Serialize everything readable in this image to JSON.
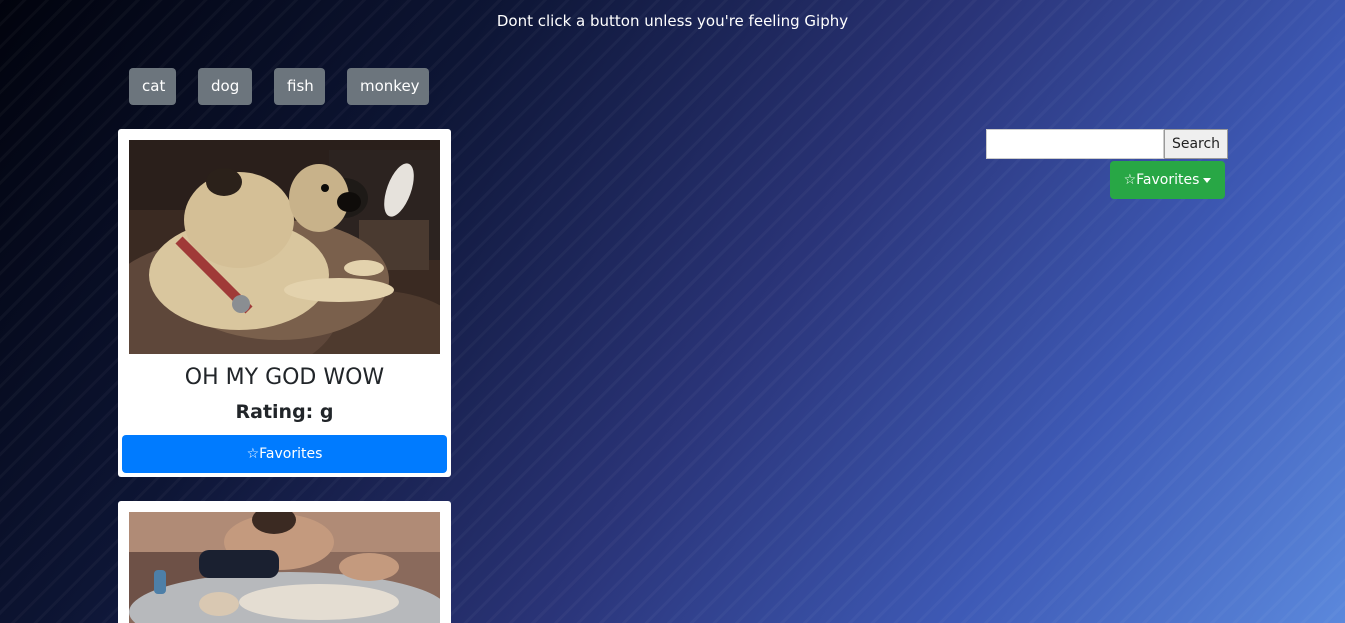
{
  "header": {
    "tagline": "Dont click a button unless you're feeling Giphy"
  },
  "topics": [
    {
      "label": "cat"
    },
    {
      "label": "dog"
    },
    {
      "label": "fish"
    },
    {
      "label": "monkey"
    }
  ],
  "search": {
    "placeholder": "",
    "value": "",
    "button_label": "Search"
  },
  "favorites_dropdown": {
    "label": "☆Favorites"
  },
  "gifs": [
    {
      "title": "OH MY GOD WOW",
      "rating": "Rating: g",
      "favorite_label": "☆Favorites"
    },
    {}
  ],
  "colors": {
    "topic_button": "#6c757d",
    "favorites_dropdown": "#28a745",
    "card_favorite_button": "#007bff"
  }
}
